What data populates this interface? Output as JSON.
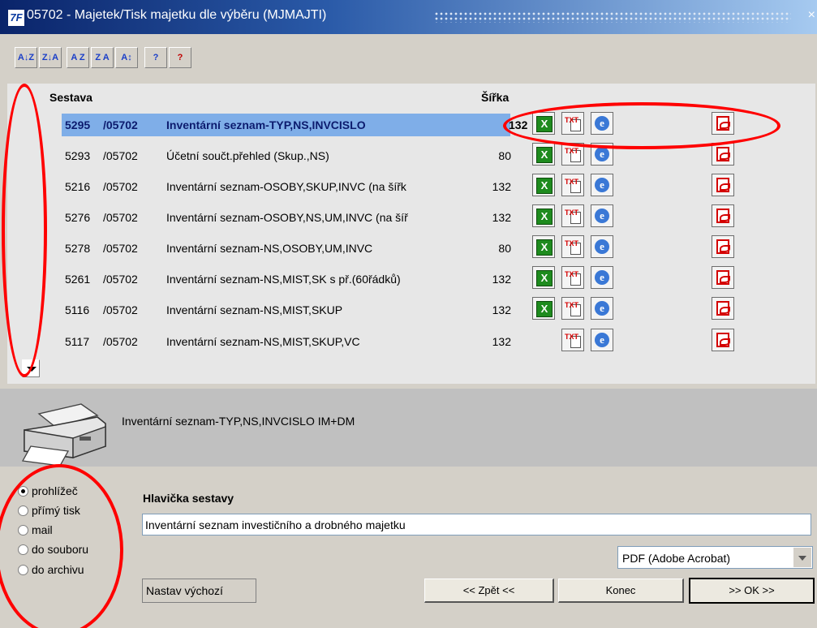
{
  "window": {
    "title": "05702 - Majetek/Tisk majetku dle výběru (MJMAJTI)",
    "logo": "7F",
    "close_glyph": "×"
  },
  "toolbar": {
    "buttons": [
      {
        "icon": "ascending-sort-icon",
        "text": "A↓Z"
      },
      {
        "icon": "descending-sort-icon",
        "text": "Z↓A"
      },
      {
        "icon": "sort-az-icon",
        "text": "A Z"
      },
      {
        "icon": "sort-za-icon",
        "text": "Z A"
      },
      {
        "icon": "multi-sort-icon",
        "text": "A↕"
      },
      {
        "icon": "help-icon",
        "text": "?"
      },
      {
        "icon": "context-help-icon",
        "text": "?"
      }
    ]
  },
  "list": {
    "header_sestava": "Sestava",
    "header_sirka": "Šířka",
    "rows": [
      {
        "id": "5295",
        "num": "/05702",
        "name": "Inventární seznam-TYP,NS,INVCISLO",
        "width": "132",
        "xls": true,
        "selected": true
      },
      {
        "id": "5293",
        "num": "/05702",
        "name": "Účetní součt.přehled (Skup.,NS)",
        "width": "80",
        "xls": true,
        "selected": false
      },
      {
        "id": "5216",
        "num": "/05702",
        "name": "Inventární seznam-OSOBY,SKUP,INVC (na šířk",
        "width": "132",
        "xls": true,
        "selected": false
      },
      {
        "id": "5276",
        "num": "/05702",
        "name": "Inventární seznam-OSOBY,NS,UM,INVC (na šíř",
        "width": "132",
        "xls": true,
        "selected": false
      },
      {
        "id": "5278",
        "num": "/05702",
        "name": "Inventární seznam-NS,OSOBY,UM,INVC",
        "width": "80",
        "xls": true,
        "selected": false
      },
      {
        "id": "5261",
        "num": "/05702",
        "name": "Inventární seznam-NS,MIST,SK s př.(60řádků)",
        "width": "132",
        "xls": true,
        "selected": false
      },
      {
        "id": "5116",
        "num": "/05702",
        "name": "Inventární seznam-NS,MIST,SKUP",
        "width": "132",
        "xls": true,
        "selected": false
      },
      {
        "id": "5117",
        "num": "/05702",
        "name": "Inventární seznam-NS,MIST,SKUP,VC",
        "width": "132",
        "xls": false,
        "selected": false
      }
    ],
    "icon_labels": {
      "xls": "X",
      "txt": "TXT",
      "ie": "e"
    }
  },
  "description": {
    "text": "Inventární seznam-TYP,NS,INVCISLO IM+DM"
  },
  "output": {
    "options": [
      {
        "label": "prohlížeč",
        "checked": true
      },
      {
        "label": "přímý tisk",
        "checked": false
      },
      {
        "label": "mail",
        "checked": false
      },
      {
        "label": "do souboru",
        "checked": false
      },
      {
        "label": "do archivu",
        "checked": false
      }
    ]
  },
  "report_header": {
    "label": "Hlavička sestavy",
    "value": "Inventární seznam investičního a drobného majetku"
  },
  "format_select": {
    "value": "PDF (Adobe Acrobat)"
  },
  "buttons": {
    "defaults": "Nastav výchozí",
    "back": "<< Zpět <<",
    "end": "Konec",
    "ok": ">> OK >>"
  },
  "colors": {
    "title_gradient_start": "#0a246a",
    "selection": "#7faee8",
    "annotation": "#ff0000"
  }
}
